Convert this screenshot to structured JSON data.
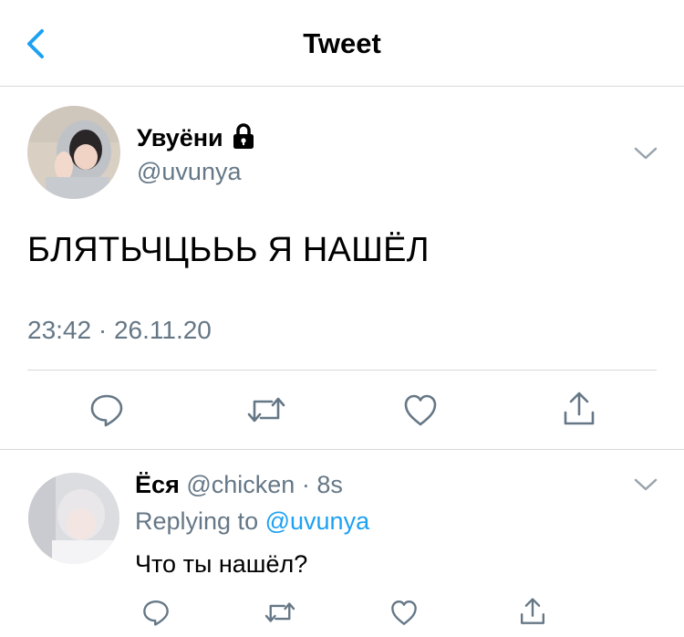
{
  "header": {
    "title": "Tweet",
    "back_icon": "chevron-left-icon",
    "accent": "#1da1f2"
  },
  "tweet": {
    "display_name": "Увуёни",
    "handle": "@uvunya",
    "locked": true,
    "text": "БЛЯТЬЧЦЬЬЬ Я НАШЁЛ",
    "timestamp": "23:42 · 26.11.20",
    "actions": [
      "reply-icon",
      "retweet-icon",
      "like-icon",
      "share-icon"
    ]
  },
  "reply": {
    "display_name": "Ёся",
    "handle": "@chicken",
    "separator": "·",
    "time": "8s",
    "replying_to_label": "Replying to",
    "replying_to_handle": "@uvunya",
    "text": "Что ты нашёл?",
    "actions": [
      "reply-icon",
      "retweet-icon",
      "like-icon",
      "share-icon"
    ]
  },
  "colors": {
    "secondary_text": "#657786",
    "divider": "#d6d9dc",
    "icon": "#657786"
  }
}
